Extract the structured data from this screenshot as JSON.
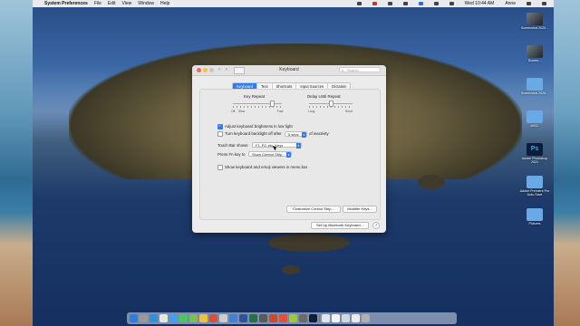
{
  "menubar": {
    "app": "System Preferences",
    "items": [
      "File",
      "Edit",
      "View",
      "Window",
      "Help"
    ],
    "clock": "Wed 10:44 AM",
    "user": "Anne"
  },
  "window": {
    "title": "Keyboard",
    "search_placeholder": "Search",
    "tabs": [
      "Keyboard",
      "Text",
      "Shortcuts",
      "Input Sources",
      "Dictation"
    ],
    "active_tab": "Keyboard",
    "key_repeat": {
      "label": "Key Repeat",
      "min_label": "Off",
      "slow_label": "Slow",
      "max_label": "Fast",
      "value": 0.8
    },
    "delay_repeat": {
      "label": "Delay Until Repeat",
      "min_label": "Long",
      "max_label": "Short",
      "value": 0.5
    },
    "adjust_brightness": {
      "label": "Adjust keyboard brightness in low light",
      "checked": true
    },
    "backlight_off": {
      "label": "Turn keyboard backlight off after",
      "value": "5 secs",
      "suffix": "of inactivity",
      "checked": false
    },
    "touch_bar": {
      "label": "Touch Bar shows",
      "value": "F1, F2, etc. Keys"
    },
    "fn_key": {
      "label": "Press Fn key to",
      "value": "Show Control Strip"
    },
    "show_viewers": {
      "label": "Show keyboard and emoji viewers in menu bar",
      "checked": false
    },
    "buttons": {
      "customize": "Customize Control Strip...",
      "modifier": "Modifier Keys...",
      "bluetooth": "Set Up Bluetooth Keyboard...",
      "help": "?"
    }
  },
  "desktop_icons": [
    {
      "name": "Screenshot 2020...",
      "kind": "image"
    },
    {
      "name": "Screen...",
      "kind": "image"
    },
    {
      "name": "Screenshot 2020...",
      "kind": "folder"
    },
    {
      "name": "MISC",
      "kind": "folder"
    },
    {
      "name": "Adobe Photoshop 2021",
      "kind": "ps"
    },
    {
      "name": "Adobe Premiere Pro Auto-Save",
      "kind": "folder"
    },
    {
      "name": "Pictures",
      "kind": "folder"
    }
  ],
  "colors": {
    "accent": "#2f7cf6",
    "window_bg": "#ececec"
  }
}
